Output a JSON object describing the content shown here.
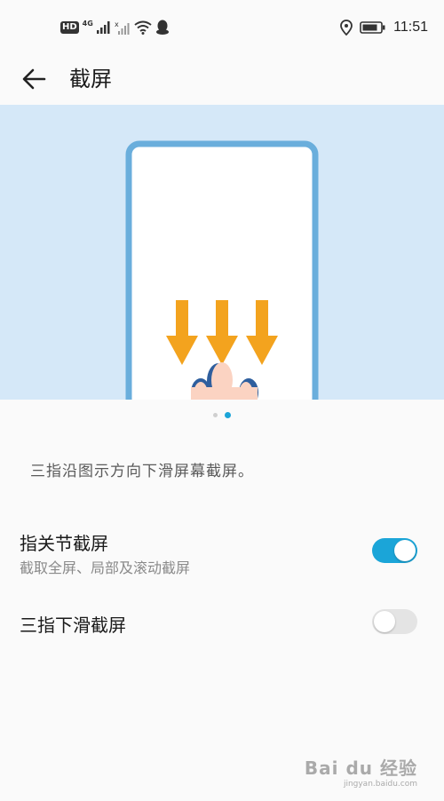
{
  "status_bar": {
    "left_icons": [
      "hd-icon",
      "4g-signal-icon",
      "signal-icon",
      "wifi-icon",
      "qq-icon"
    ],
    "hd_label": "HD",
    "network_label": "4G",
    "time": "11:51",
    "right_icons": [
      "location-icon",
      "battery-icon"
    ]
  },
  "app_bar": {
    "back_icon": "arrow-left-icon",
    "title": "截屏"
  },
  "illustration": {
    "bg_color": "#d5e8f8",
    "phone_frame_color": "#6aaedc",
    "arrow_color": "#f3a31e",
    "page_count": 2,
    "active_page": 2
  },
  "description": "三指沿图示方向下滑屏幕截屏。",
  "settings": [
    {
      "title": "指关节截屏",
      "subtitle": "截取全屏、局部及滚动截屏",
      "enabled": true
    },
    {
      "title": "三指下滑截屏",
      "subtitle": "",
      "enabled": false
    }
  ],
  "accent_color": "#1ba5d8",
  "watermark": {
    "brand": "Bai du 经验",
    "url": "jingyan.baidu.com"
  }
}
